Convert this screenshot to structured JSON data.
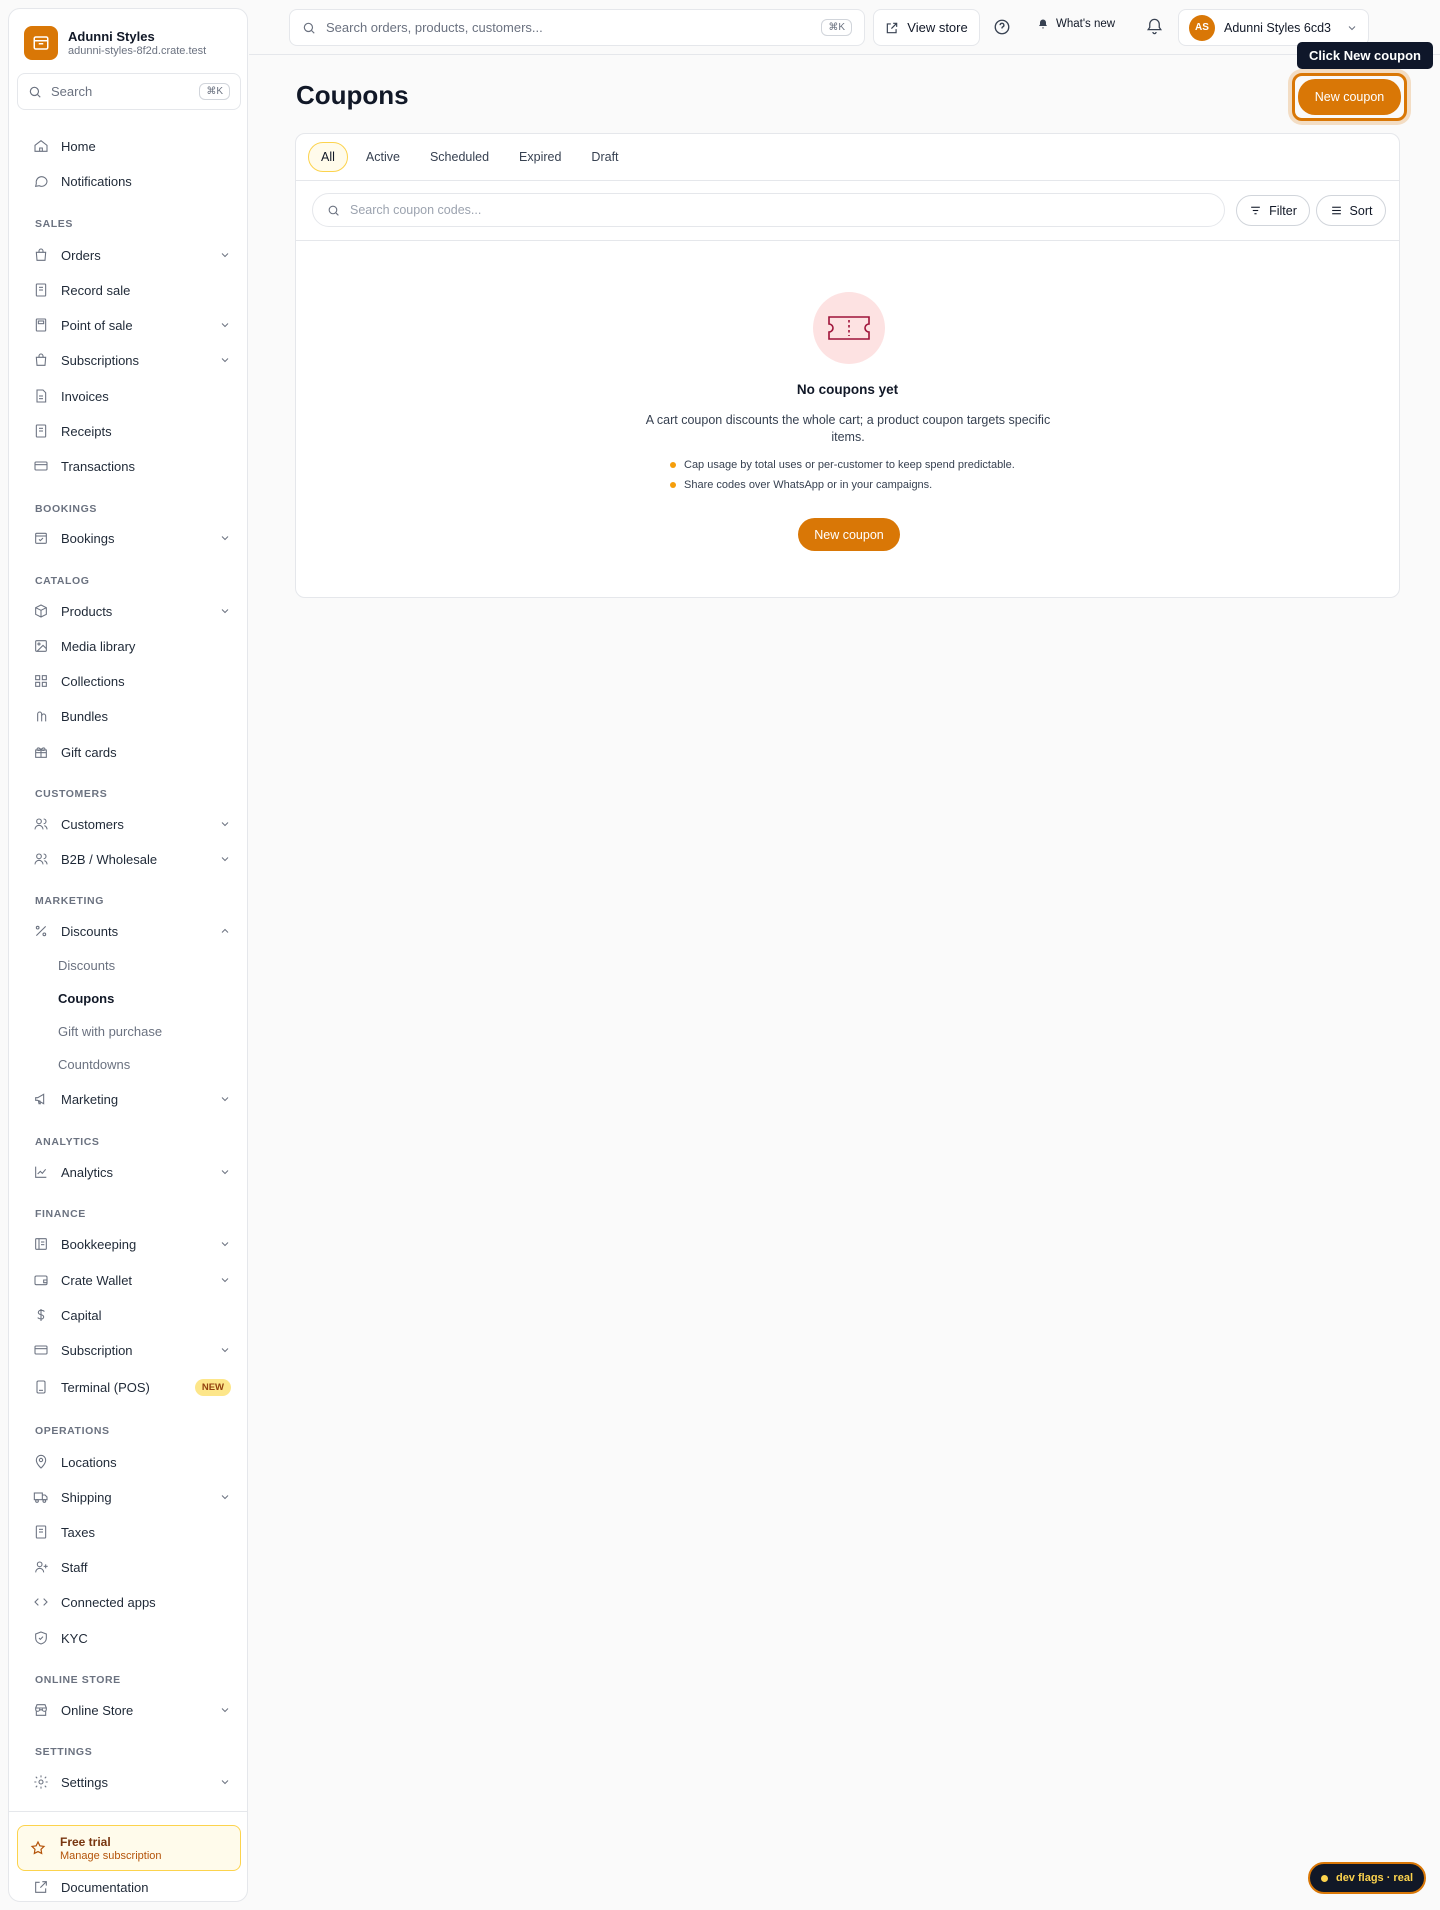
{
  "brand": {
    "name": "Adunni Styles",
    "domain": "adunni-styles-8f2d.crate.test"
  },
  "sidebar": {
    "search_placeholder": "Search",
    "search_kbd": "⌘K",
    "home": "Home",
    "notifications": "Notifications",
    "sections": {
      "sales": "SALES",
      "bookings": "BOOKINGS",
      "catalog": "CATALOG",
      "customers": "CUSTOMERS",
      "marketing": "MARKETING",
      "analytics": "ANALYTICS",
      "finance": "FINANCE",
      "operations": "OPERATIONS",
      "online_store": "ONLINE STORE",
      "settings": "SETTINGS"
    },
    "items": {
      "orders": "Orders",
      "record_sale": "Record sale",
      "point_of_sale": "Point of sale",
      "subscriptions": "Subscriptions",
      "invoices": "Invoices",
      "receipts": "Receipts",
      "transactions": "Transactions",
      "bookings": "Bookings",
      "products": "Products",
      "media_library": "Media library",
      "collections": "Collections",
      "bundles": "Bundles",
      "gift_cards": "Gift cards",
      "customers": "Customers",
      "b2b": "B2B / Wholesale",
      "discounts": "Discounts",
      "marketing": "Marketing",
      "analytics": "Analytics",
      "bookkeeping": "Bookkeeping",
      "crate_wallet": "Crate Wallet",
      "capital": "Capital",
      "subscription": "Subscription",
      "terminal": "Terminal (POS)",
      "locations": "Locations",
      "shipping": "Shipping",
      "taxes": "Taxes",
      "staff": "Staff",
      "connected_apps": "Connected apps",
      "kyc": "KYC",
      "online_store": "Online Store",
      "settings": "Settings",
      "documentation": "Documentation"
    },
    "discount_subitems": {
      "discounts": "Discounts",
      "coupons": "Coupons",
      "gift_with_purchase": "Gift with purchase",
      "countdowns": "Countdowns"
    },
    "terminal_badge": "NEW",
    "trial": {
      "title": "Free trial",
      "subtitle": "Manage subscription"
    }
  },
  "topbar": {
    "search_placeholder": "Search orders, products, customers...",
    "search_kbd": "⌘K",
    "view_store": "View store",
    "whats_new": "What's new",
    "account_initials": "AS",
    "account_name": "Adunni Styles 6cd3"
  },
  "page": {
    "title": "Coupons",
    "new_coupon": "New coupon",
    "tooltip": "Click New coupon",
    "tabs": [
      "All",
      "Active",
      "Scheduled",
      "Expired",
      "Draft"
    ],
    "search_placeholder": "Search coupon codes...",
    "filter": "Filter",
    "sort": "Sort",
    "empty": {
      "title": "No coupons yet",
      "description": "A cart coupon discounts the whole cart; a product coupon targets specific items.",
      "tips": [
        "Cap usage by total uses or per-customer to keep spend predictable.",
        "Share codes over WhatsApp or in your campaigns."
      ],
      "cta": "New coupon"
    }
  },
  "dev_flags": "dev flags · real",
  "colors": {
    "accent": "#d97706",
    "accent_light": "#fffbeb",
    "empty_icon_bg": "#fde2e2",
    "empty_icon_stroke": "#9f1239"
  }
}
